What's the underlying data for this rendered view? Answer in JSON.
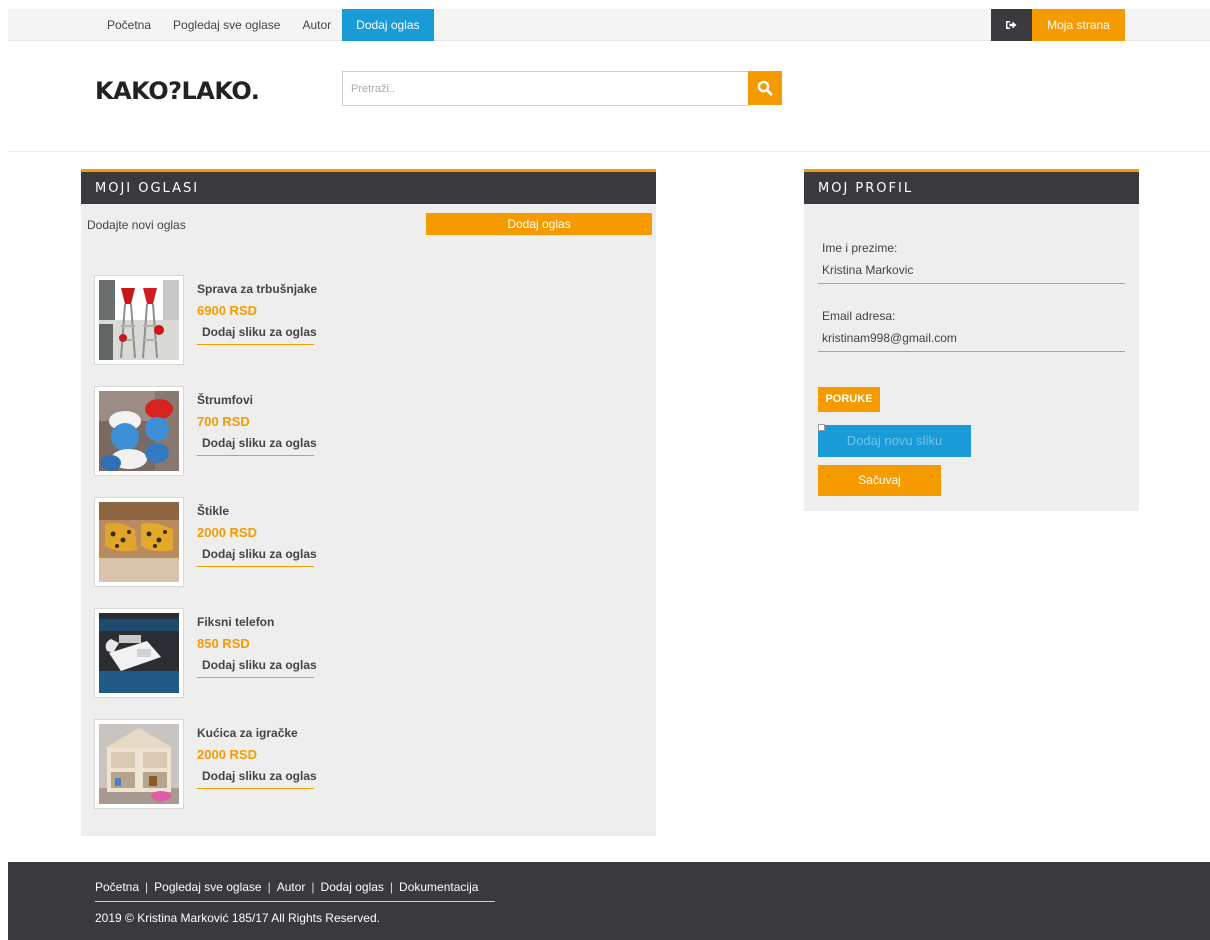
{
  "nav": {
    "items": [
      {
        "label": "Početna"
      },
      {
        "label": "Pogledaj sve oglase"
      },
      {
        "label": "Autor"
      },
      {
        "label": "Dodaj oglas"
      }
    ],
    "moja_strana": "Moja strana",
    "logout_icon": "sign-out-icon"
  },
  "header": {
    "logo": "KAKO?LAKO.",
    "search_placeholder": "Pretraži..",
    "search_icon": "search-icon"
  },
  "ads_panel": {
    "title": "MOJI OGLASI",
    "add_text": "Dodajte novi oglas",
    "add_button": "Dodaj oglas",
    "ads": [
      {
        "title": "Sprava za trbušnjake",
        "price": "6900 RSD",
        "action": "Dodaj sliku za oglas"
      },
      {
        "title": "Štrumfovi",
        "price": "700 RSD",
        "action": "Dodaj sliku za oglas"
      },
      {
        "title": "Štikle",
        "price": "2000 RSD",
        "action": "Dodaj sliku za oglas"
      },
      {
        "title": "Fiksni telefon",
        "price": "850 RSD",
        "action": "Dodaj sliku za oglas"
      },
      {
        "title": "Kućica za igračke",
        "price": "2000 RSD",
        "action": "Dodaj sliku za oglas"
      }
    ]
  },
  "profile": {
    "title": "MOJ PROFIL",
    "name_label": "Ime i prezime:",
    "name_value": "Kristina Markovic",
    "email_label": "Email adresa:",
    "email_value": "kristinam998@gmail.com",
    "messages_button": "PORUKE",
    "upload_button": "Dodaj novu sliku",
    "save_button": "Sačuvaj"
  },
  "footer": {
    "links": [
      {
        "label": "Početna"
      },
      {
        "label": "Pogledaj sve oglase"
      },
      {
        "label": "Autor"
      },
      {
        "label": "Dodaj oglas"
      },
      {
        "label": "Dokumentacija"
      }
    ],
    "copyright": "2019 © Kristina Marković 185/17 All Rights Reserved."
  },
  "colors": {
    "accent": "#f59b00",
    "primary": "#1a9ad6",
    "dark": "#3a3a3e",
    "panel_bg": "#eeeeee"
  }
}
